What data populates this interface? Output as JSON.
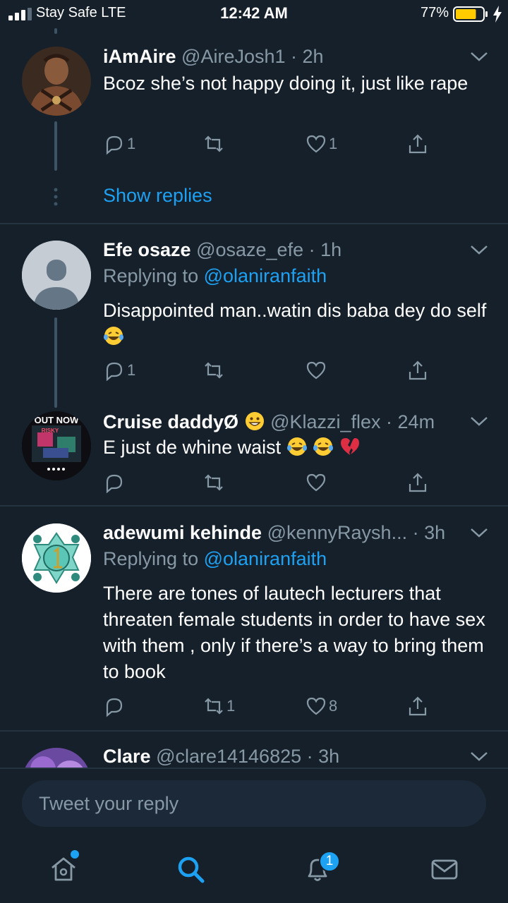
{
  "status_bar": {
    "carrier": "Stay Safe  LTE",
    "time": "12:42 AM",
    "battery": "77%",
    "battery_level": 0.77
  },
  "tweets": [
    {
      "name": "iAmAire",
      "meta": "@AireJosh1 · 2h",
      "text": "Bcoz she’s not happy doing it, just like rape",
      "reply_count": "1",
      "retweet_count": "",
      "like_count": "1",
      "avatar": "man-with-ornaments"
    },
    {
      "name": "Efe osaze",
      "meta": "@osaze_efe · 1h",
      "replying_label": "Replying to",
      "replying_to": "@olaniranfaith",
      "text": "Disappointed man..watin dis baba dey do self",
      "reply_count": "1",
      "retweet_count": "",
      "like_count": "",
      "avatar": "default-avatar"
    },
    {
      "name": "Cruise daddyØ",
      "meta": "@Klazzi_flex · 24m",
      "text": "E just de whine waist",
      "reply_count": "",
      "retweet_count": "",
      "like_count": "",
      "avatar": "album-art",
      "avatar_text_1": "OUT NOW",
      "avatar_text_2": "RISKY"
    },
    {
      "name": "adewumi kehinde",
      "meta": "@kennyRaysh... · 3h",
      "replying_label": "Replying to",
      "replying_to": "@olaniranfaith",
      "text": "There are tones of lautech lecturers that threaten female students in order to have sex with them , only if there’s a way to bring them to book",
      "reply_count": "",
      "retweet_count": "1",
      "like_count": "8",
      "avatar": "teal-emblem"
    },
    {
      "name": "Clare",
      "meta": "@clare14146825 · 3h",
      "avatar": "purple-photo"
    }
  ],
  "show_replies": "Show replies",
  "reply_bar": {
    "placeholder": "Tweet your reply"
  },
  "tab_bar": {
    "notifications_badge": "1",
    "icons": [
      "home-icon",
      "search-icon",
      "bell-icon",
      "mail-icon"
    ]
  },
  "colors": {
    "background": "#15202b",
    "accent": "#1da1f2",
    "muted": "#8899a6",
    "divider": "#253341",
    "battery": "#ffcc00"
  }
}
